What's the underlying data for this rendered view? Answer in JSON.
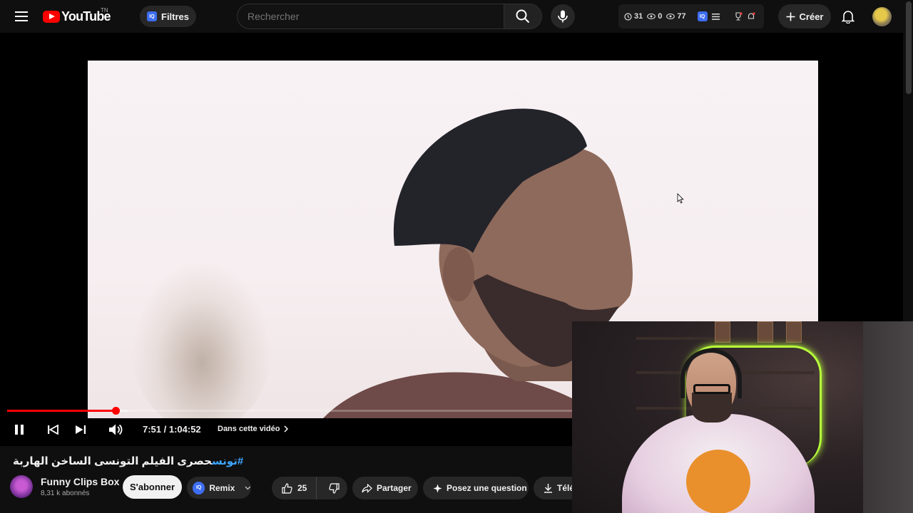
{
  "header": {
    "logo_text": "YouTube",
    "country_code": "TN",
    "filters_label": "Filtres",
    "iq_badge": "IQ",
    "search_placeholder": "Rechercher",
    "ext_stats": {
      "history": "31",
      "unwatched": "0",
      "watched": "77"
    },
    "create_label": "Créer"
  },
  "player": {
    "current_time": "7:51",
    "duration": "1:04:52",
    "time_display": "7:51 / 1:04:52",
    "progress_fraction": 0.121,
    "buffer_fraction": 0.135,
    "chapter_label": "Dans cette vidéo"
  },
  "video": {
    "title_hashtag": "#تونس",
    "title_text": "حصرى الفيلم التونسى الساخن الهاربة"
  },
  "channel": {
    "name": "Funny Clips Box",
    "subscribers": "8,31 k abonnés",
    "subscribe_label": "S'abonner",
    "remix_label": "Remix",
    "remix_badge": "IQ"
  },
  "actions": {
    "like_count": "25",
    "share_label": "Partager",
    "ask_label": "Posez une question",
    "download_label": "Télé"
  },
  "colors": {
    "accent": "#ff0000",
    "background": "#0f0f0f",
    "link": "#3ea6ff",
    "pill": "#272727"
  }
}
